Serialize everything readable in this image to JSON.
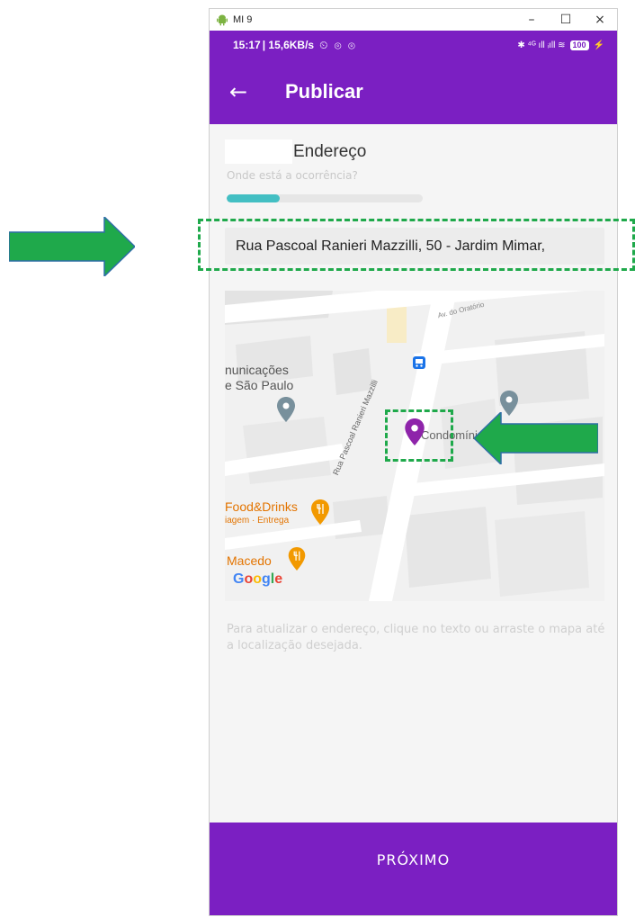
{
  "window": {
    "title": "MI 9",
    "controls": {
      "minimize": "–",
      "maximize": "☐",
      "close": "×"
    }
  },
  "statusbar": {
    "time": "15:17",
    "network": "| 15,6KB/s",
    "icons": "⏲ ⊚ ⊚",
    "right_icons": "✱ ⁴ᴳ ıll ᵢıll ≋",
    "battery": "100"
  },
  "appbar": {
    "back_icon": "←",
    "title": "Publicar"
  },
  "form": {
    "heading": "Endereço",
    "question": "Onde está a ocorrência?",
    "progress": 0.27,
    "address": "Rua Pascoal Ranieri Mazzilli, 50 - Jardim Mimar,",
    "hint": "Para atualizar o endereço, clique no texto ou arraste o mapa até a localização desejada."
  },
  "map": {
    "labels": {
      "street_top": "Av. do Oratório",
      "comunicacoes": "nunicações",
      "sao_paulo": "e São Paulo",
      "street": "Rua Pascoal Ranieri Mazzilli",
      "condominio": "Condomínio",
      "food": "Food&Drinks",
      "food_sub": "iagem · Entrega",
      "macedo": "Macedo",
      "google": "Google"
    },
    "icons": [
      "bus-icon",
      "place-pin-icon",
      "restaurant-icon",
      "location-marker-icon"
    ],
    "colors": {
      "marker": "#8e24aa",
      "pin": "#78909c",
      "restaurant": "#f29900",
      "bus": "#1a73e8"
    }
  },
  "footer": {
    "next_label": "PRÓXIMO"
  },
  "colors": {
    "primary": "#7b1fc2",
    "progress": "#43bfc3",
    "annotation": "#1fa94b"
  }
}
